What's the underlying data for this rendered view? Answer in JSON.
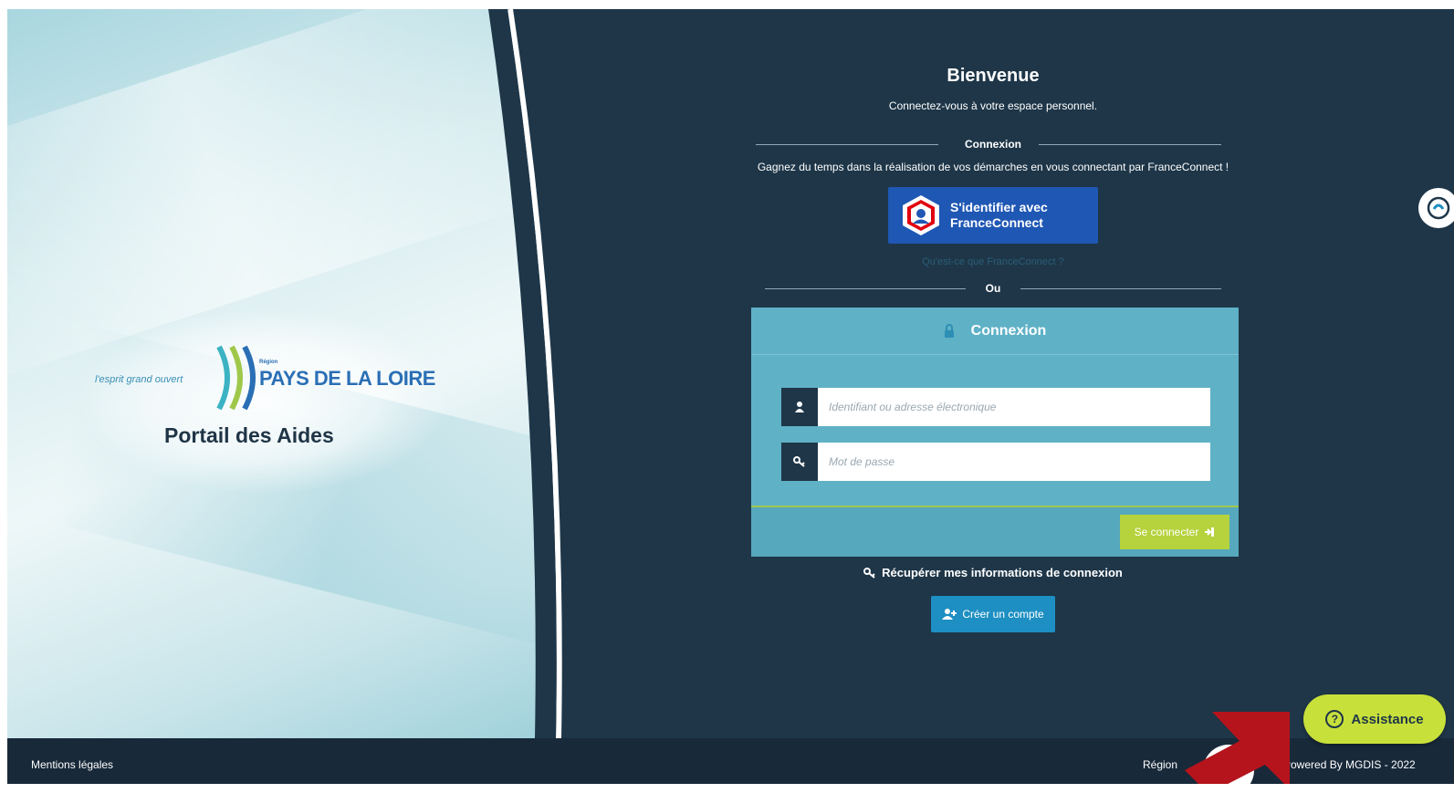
{
  "hero": {
    "slogan": "l'esprit grand ouvert",
    "region_small": "Région",
    "region_name": "PAYS DE LA LOIRE",
    "portal_title": "Portail des Aides"
  },
  "welcome": {
    "title": "Bienvenue",
    "subtitle": "Connectez-vous à votre espace personnel."
  },
  "franceconnect": {
    "section_label": "Connexion",
    "description": "Gagnez du temps dans la réalisation de vos démarches en vous connectant par FranceConnect !",
    "button_line1": "S'identifier avec",
    "button_line2": "FranceConnect",
    "info_link": "Qu'est-ce que FranceConnect ?"
  },
  "or_label": "Ou",
  "login": {
    "title": "Connexion",
    "username_placeholder": "Identifiant ou adresse électronique",
    "password_placeholder": "Mot de passe",
    "submit_label": "Se connecter",
    "recover_label": "Récupérer mes informations de connexion",
    "create_label": "Créer un compte"
  },
  "footer": {
    "legal": "Mentions légales",
    "region": "Région",
    "powered": "Powered By MGDIS - 2022"
  },
  "assistance": {
    "label": "Assistance"
  },
  "colors": {
    "navy": "#1e3648",
    "card": "#5fb1c6",
    "accent_green": "#b6d23c",
    "franceconnect_blue": "#1f57b4",
    "create_blue": "#1d8fc2",
    "arrow_red": "#b5141c"
  },
  "icons": [
    "user-icon",
    "key-icon",
    "lock-icon",
    "sign-in-icon",
    "user-plus-icon",
    "question-circle-icon",
    "franceconnect-logo-icon"
  ]
}
